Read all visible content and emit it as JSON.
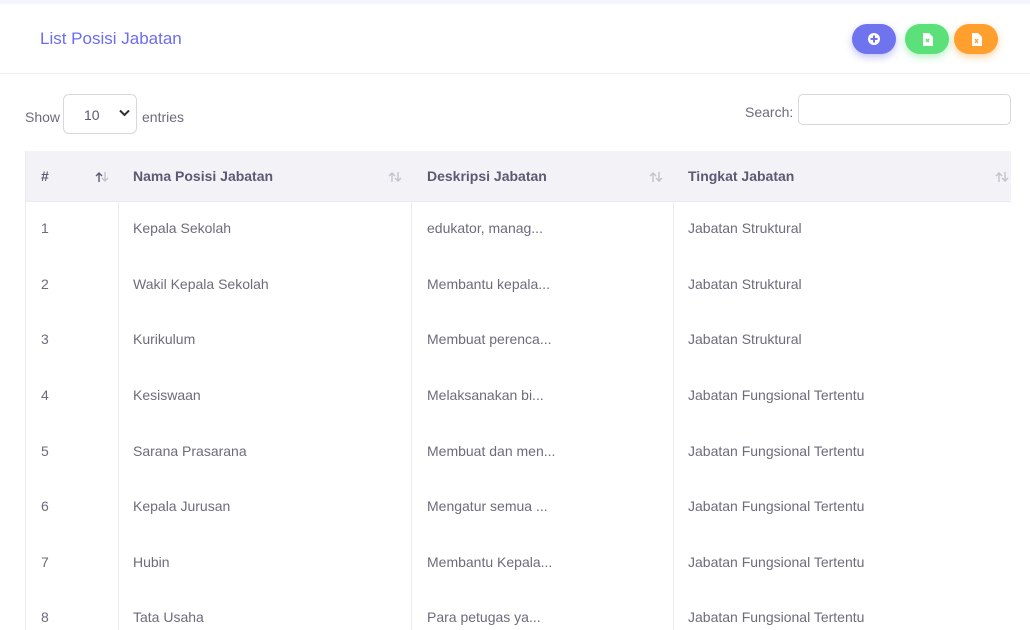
{
  "header": {
    "title": "List Posisi Jabatan"
  },
  "length": {
    "show_label": "Show",
    "value": "10",
    "entries_label": "entries"
  },
  "search": {
    "label": "Search:",
    "value": ""
  },
  "table": {
    "columns": [
      "#",
      "Nama Posisi Jabatan",
      "Deskripsi Jabatan",
      "Tingkat Jabatan"
    ],
    "sorted_column": "#",
    "sort_direction": "ascending",
    "rows": [
      {
        "no": "1",
        "nama": "Kepala Sekolah",
        "deskripsi": "edukator, manag...",
        "tingkat": "Jabatan Struktural"
      },
      {
        "no": "2",
        "nama": "Wakil Kepala Sekolah",
        "deskripsi": "Membantu kepala...",
        "tingkat": "Jabatan Struktural"
      },
      {
        "no": "3",
        "nama": "Kurikulum",
        "deskripsi": "Membuat perenca...",
        "tingkat": "Jabatan Struktural"
      },
      {
        "no": "4",
        "nama": "Kesiswaan",
        "deskripsi": "Melaksanakan bi...",
        "tingkat": "Jabatan Fungsional Tertentu"
      },
      {
        "no": "5",
        "nama": "Sarana Prasarana",
        "deskripsi": "Membuat dan men...",
        "tingkat": "Jabatan Fungsional Tertentu"
      },
      {
        "no": "6",
        "nama": "Kepala Jurusan",
        "deskripsi": "Mengatur semua ...",
        "tingkat": "Jabatan Fungsional Tertentu"
      },
      {
        "no": "7",
        "nama": "Hubin",
        "deskripsi": "Membantu Kepala...",
        "tingkat": "Jabatan Fungsional Tertentu"
      },
      {
        "no": "8",
        "nama": "Tata Usaha",
        "deskripsi": "Para petugas ya...",
        "tingkat": "Jabatan Fungsional Tertentu"
      }
    ]
  },
  "buttons": [
    {
      "name": "add-button",
      "icon": "plus-circle-icon",
      "color": "#6f74ee"
    },
    {
      "name": "export-pdf-button",
      "icon": "file-icon",
      "color": "#5be07a"
    },
    {
      "name": "export-excel-button",
      "icon": "file-x-icon",
      "color": "#ff9f2e"
    }
  ],
  "colors": {
    "title": "#6c6cf2",
    "header_bg": "#f3f2f7"
  }
}
